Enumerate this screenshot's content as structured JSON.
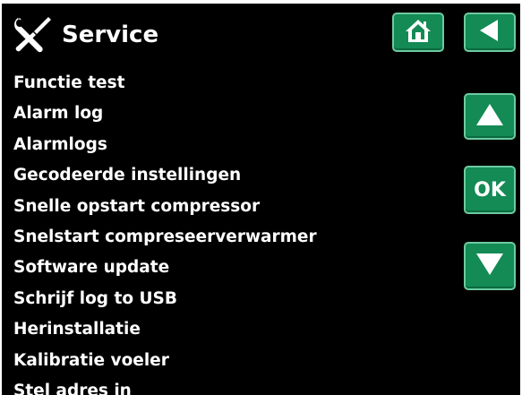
{
  "header": {
    "title": "Service",
    "icon": "tools-icon"
  },
  "nav": {
    "home_icon": "home-icon",
    "back_icon": "back-arrow-icon",
    "up_icon": "arrow-up-icon",
    "ok_label": "OK",
    "down_icon": "arrow-down-icon"
  },
  "menu": {
    "items": [
      "Functie test",
      "Alarm log",
      "Alarmlogs",
      "Gecodeerde instellingen",
      "Snelle opstart compressor",
      "Snelstart compreseerverwarmer",
      "Software update",
      "Schrijf log to USB",
      "Herinstallatie",
      "Kalibratie voeler",
      "Stel adres in"
    ]
  },
  "colors": {
    "background": "#000000",
    "text": "#ffffff",
    "button_fill": "#148a55",
    "button_border": "#6ecaa0"
  }
}
